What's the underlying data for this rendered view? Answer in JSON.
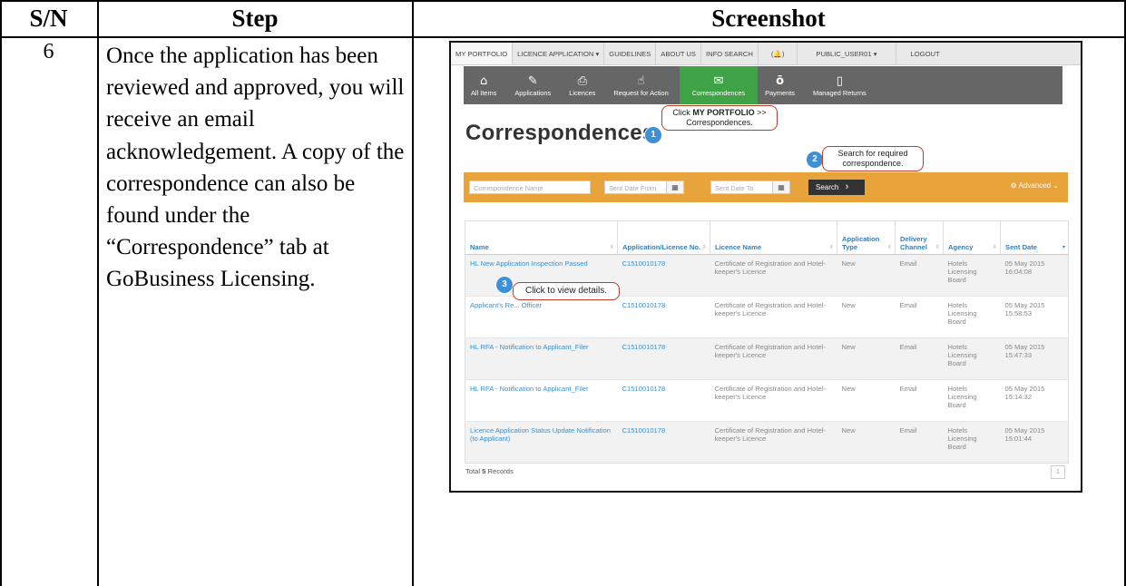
{
  "table_headers": {
    "sn": "S/N",
    "step": "Step",
    "screenshot": "Screenshot"
  },
  "row": {
    "sn": "6",
    "step_text": "Once the application has been reviewed and approved, you will receive an email acknowledgement. A copy of the correspondence can also be found under the “Correspondence” tab at GoBusiness Licensing."
  },
  "screenshot": {
    "top_nav": [
      "MY PORTFOLIO",
      "LICENCE APPLICATION ▾",
      "GUIDELINES",
      "ABOUT US",
      "INFO SEARCH",
      "(🔔)",
      "PUBLIC_USER01 ▾",
      "LOGOUT"
    ],
    "icon_tabs": [
      {
        "icon": "home-icon",
        "glyph": "⌂",
        "label": "All Items"
      },
      {
        "icon": "pencil-icon",
        "glyph": "✎",
        "label": "Applications"
      },
      {
        "icon": "licence-icon",
        "glyph": "⎙",
        "label": "Licences"
      },
      {
        "icon": "hand-pointer-icon",
        "glyph": "☝",
        "label": "Request for Action"
      },
      {
        "icon": "envelope-icon",
        "glyph": "✉",
        "label": "Correspondences"
      },
      {
        "icon": "money-bag-icon",
        "glyph": "ō",
        "label": "Payments"
      },
      {
        "icon": "document-icon",
        "glyph": "▯",
        "label": "Managed Returns"
      }
    ],
    "page_title": "Correspondences",
    "callouts": [
      {
        "num": "1",
        "text_bold": "MY PORTFOLIO",
        "text_pre": "Click ",
        "text_post": " >> Correspondences."
      },
      {
        "num": "2",
        "text": "Search for required correspondence."
      },
      {
        "num": "3",
        "text": "Click to view details."
      }
    ],
    "search": {
      "name_placeholder": "Correspondence Name",
      "from_placeholder": "Sent Date From",
      "to_placeholder": "Sent Date To",
      "search_label": "Search",
      "advanced_label": "Advanced"
    },
    "columns": [
      "Name",
      "Application/Licence No.",
      "Licence Name",
      "Application Type",
      "Delivery Channel",
      "Agency",
      "Sent Date"
    ],
    "rows": [
      {
        "name": "HL New Application Inspection Passed",
        "no": "C1510010178",
        "licence": "Certificate of Registration and Hotel-keeper's Licence",
        "type": "New",
        "channel": "Email",
        "agency": "Hotels Licensing Board",
        "date": "05 May 2015 16:04:08"
      },
      {
        "name": "Applicant's Re... Officer",
        "no": "C1510010178",
        "licence": "Certificate of Registration and Hotel-keeper's Licence",
        "type": "New",
        "channel": "Email",
        "agency": "Hotels Licensing Board",
        "date": "05 May 2015 15:58:53"
      },
      {
        "name": "HL RFA - Notification to Applicant_Filer",
        "no": "C1510010178",
        "licence": "Certificate of Registration and Hotel-keeper's Licence",
        "type": "New",
        "channel": "Email",
        "agency": "Hotels Licensing Board",
        "date": "05 May 2015 15:47:33"
      },
      {
        "name": "HL RFA - Notification to Applicant_Filer",
        "no": "C1510010178",
        "licence": "Certificate of Registration and Hotel-keeper's Licence",
        "type": "New",
        "channel": "Email",
        "agency": "Hotels Licensing Board",
        "date": "05 May 2015 15:14:32"
      },
      {
        "name": "Licence Application Status Update Notification (to Applicant)",
        "no": "C1510010178",
        "licence": "Certificate of Registration and Hotel-keeper's Licence",
        "type": "New",
        "channel": "Email",
        "agency": "Hotels Licensing Board",
        "date": "05 May 2015 15:01:44"
      }
    ],
    "total_prefix": "Total ",
    "total_count": "5",
    "total_suffix": " Records",
    "page_number": "1"
  }
}
